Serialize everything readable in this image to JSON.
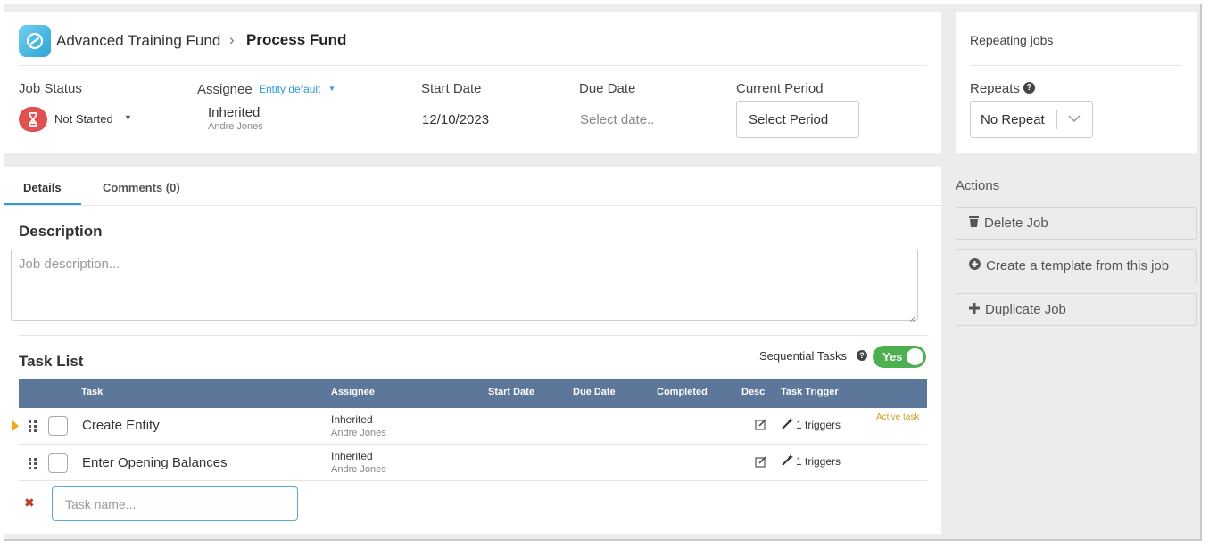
{
  "header": {
    "breadcrumb_parent": "Advanced Training Fund",
    "breadcrumb_current": "Process Fund"
  },
  "job": {
    "status_label": "Job Status",
    "status_value": "Not Started",
    "assignee_label": "Assignee",
    "assignee_link": "Entity default",
    "assignee_value": "Inherited",
    "assignee_sub": "Andre Jones",
    "start_label": "Start Date",
    "start_value": "12/10/2023",
    "due_label": "Due Date",
    "due_placeholder": "Select date..",
    "period_label": "Current Period",
    "period_button": "Select Period"
  },
  "repeating": {
    "title": "Repeating jobs",
    "repeats_label": "Repeats",
    "repeats_value": "No Repeat"
  },
  "tabs": [
    {
      "label": "Details"
    },
    {
      "label": "Comments (0)"
    }
  ],
  "description": {
    "title": "Description",
    "placeholder": "Job description..."
  },
  "tasklist": {
    "title": "Task List",
    "sequential_label": "Sequential Tasks",
    "toggle_value": "Yes",
    "columns": [
      "Task",
      "Assignee",
      "Start Date",
      "Due Date",
      "Completed",
      "Desc",
      "Task Trigger"
    ],
    "rows": [
      {
        "name": "Create Entity",
        "assignee": "Inherited",
        "assignee_sub": "Andre Jones",
        "triggers": "1 triggers",
        "badge": "Active task"
      },
      {
        "name": "Enter Opening Balances",
        "assignee": "Inherited",
        "assignee_sub": "Andre Jones",
        "triggers": "1 triggers",
        "badge": ""
      }
    ],
    "new_task_placeholder": "Task name..."
  },
  "actions": {
    "title": "Actions",
    "delete": "Delete Job",
    "template": "Create a template from this job",
    "duplicate": "Duplicate Job"
  },
  "colors": {
    "accent": "#2e9bd6",
    "header_bg": "#5c7799",
    "toggle_on": "#4caf50",
    "status_red": "#e05252",
    "active_task": "#d19f2a"
  }
}
